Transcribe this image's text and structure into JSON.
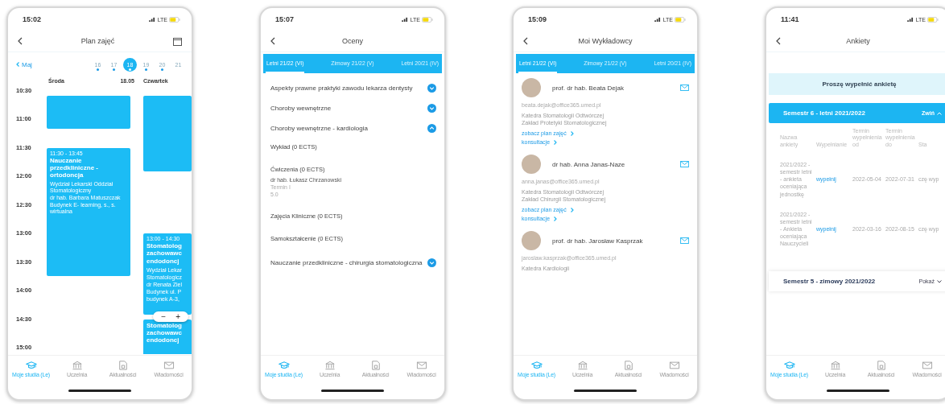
{
  "phones": [
    {
      "kind": "schedule",
      "time": "15:02",
      "network": "LTE",
      "title": "Plan zajęć",
      "calendar_button": true,
      "month": "Maj",
      "days": [
        {
          "label": "16",
          "selected": false,
          "has_events": true
        },
        {
          "label": "17",
          "selected": false,
          "has_events": true
        },
        {
          "label": "18",
          "selected": true,
          "has_events": true
        },
        {
          "label": "19",
          "selected": false,
          "has_events": true
        },
        {
          "label": "20",
          "selected": false,
          "has_events": true
        },
        {
          "label": "21",
          "selected": false,
          "has_events": false
        }
      ],
      "hours": [
        "10:30",
        "11:00",
        "11:30",
        "12:00",
        "12:30",
        "13:00",
        "13:30",
        "14:00",
        "14:30",
        "15:00"
      ],
      "columns": [
        {
          "day": "Środa",
          "date": "18.05",
          "events": [
            {
              "kind": "plain"
            },
            {
              "kind": "detailed",
              "time": "11:30 - 13:45",
              "title": "Nauczanie przedkliniczne - ortodoncja",
              "details": [
                "Wydział Lekarski Oddział Stomatologiczny",
                "dr hab. Barbara Matuszczak",
                "Budynek E- learning, s., s. wirtualna"
              ]
            }
          ]
        },
        {
          "day": "Czwartek",
          "events": [
            {
              "kind": "plain"
            },
            {
              "kind": "detailed",
              "time": "13:00 - 14:30",
              "title": "Stomatolog zachowawc endodoncj",
              "details": [
                "Wydział Lekar",
                "Stomatologicz",
                "dr Renata Ziel",
                "Budynek ul. P",
                "budynek A-3,"
              ]
            },
            {
              "kind": "detailed",
              "title": "Stomatolog zachowawc endodoncj"
            }
          ]
        }
      ],
      "zoom_control": {
        "minus": "−",
        "plus": "+"
      },
      "nav": [
        {
          "label": "Moje studia (Le)",
          "selected": true
        },
        {
          "label": "Uczelnia",
          "selected": false
        },
        {
          "label": "Aktualności",
          "selected": false
        },
        {
          "label": "Wiadomości",
          "selected": false
        }
      ]
    },
    {
      "kind": "grades",
      "time": "15:07",
      "network": "LTE",
      "title": "Oceny",
      "tabs": [
        {
          "label": "Letni 21/22 (VI)",
          "selected": true
        },
        {
          "label": "Zimowy 21/22 (V)",
          "selected": false
        },
        {
          "label": "Letni 20/21 (IV)",
          "selected": false
        }
      ],
      "courses": [
        {
          "name": "Aspekty prawne praktyki zawodu lekarza dentysty",
          "expanded": false
        },
        {
          "name": "Choroby wewnętrzne",
          "expanded": false
        },
        {
          "name": "Choroby wewnętrzne - kardiologia",
          "expanded": true,
          "components": [
            {
              "name": "Wykład (0 ECTS)"
            },
            {
              "name": "Ćwiczenia (0 ECTS)",
              "teacher": "dr hab. Łukasz Chrzanowski",
              "term": "Termin I",
              "grade": "5.0"
            },
            {
              "name": "Zajęcia Kliniczne (0 ECTS)"
            },
            {
              "name": "Samokształcenie (0 ECTS)"
            }
          ]
        },
        {
          "name": "Nauczanie przedkliniczne - chirurgia stomatologiczna",
          "expanded": false
        }
      ],
      "nav": [
        {
          "label": "Moje studia (Le)",
          "selected": true
        },
        {
          "label": "Uczelnia",
          "selected": false
        },
        {
          "label": "Aktualności",
          "selected": false
        },
        {
          "label": "Wiadomości",
          "selected": false
        }
      ]
    },
    {
      "kind": "lecturers",
      "time": "15:09",
      "network": "LTE",
      "title": "Moi Wykładowcy",
      "tabs": [
        {
          "label": "Letni 21/22 (VI)",
          "selected": true
        },
        {
          "label": "Zimowy 21/22 (V)",
          "selected": false
        },
        {
          "label": "Letni 20/21 (IV)",
          "selected": false
        }
      ],
      "lecturers": [
        {
          "name": "prof. dr hab. Beata Dejak",
          "email": "beata.dejak@office365.umed.pl",
          "departments": [
            "Katedra Stomatologii Odtwórczej",
            "Zakład Protetyki Stomatologicznej"
          ],
          "links": [
            "zobacz plan zajęć",
            "konsultacje"
          ]
        },
        {
          "name": "dr hab. Anna Janas-Naze",
          "email": "anna.janas@office365.umed.pl",
          "departments": [
            "Katedra Stomatologii Odtwórczej",
            "Zakład Chirurgii Stomatologicznej"
          ],
          "links": [
            "zobacz plan zajęć",
            "konsultacje"
          ]
        },
        {
          "name": "prof. dr hab. Jarosław Kasprzak",
          "email": "jaroslaw.kasprzak@office365.umed.pl",
          "departments": [
            "Katedra Kardiologii"
          ]
        }
      ],
      "nav": [
        {
          "label": "Moje studia (Le)",
          "selected": true
        },
        {
          "label": "Uczelnia",
          "selected": false
        },
        {
          "label": "Aktualności",
          "selected": false
        },
        {
          "label": "Wiadomości",
          "selected": false
        }
      ]
    },
    {
      "kind": "surveys",
      "time": "11:41",
      "network": "LTE",
      "title": "Ankiety",
      "banner": "Proszę wypełnić ankietę",
      "semesters": [
        {
          "title": "Semestr 6 - letni 2021/2022",
          "toggle": "Zwiń",
          "expanded": true,
          "columns": [
            "Nazwa ankiety",
            "Wypełnianie",
            "Termin wypełnienia od",
            "Termin wypełnienia do",
            "Sta"
          ],
          "rows": [
            {
              "name": "2021/2022 - semestr letni - ankieta oceniająca jednostkę",
              "action": "wypełnij",
              "from": "2022-05-04",
              "to": "2022-07-31",
              "status": "czę wyp"
            },
            {
              "name": "2021/2022 - semestr letni - Ankieta oceniająca Nauczycieli",
              "action": "wypełnij",
              "from": "2022-03-16",
              "to": "2022-08-15",
              "status": "czę wyp"
            }
          ]
        },
        {
          "title": "Semestr 5 - zimowy 2021/2022",
          "toggle": "Pokaż",
          "expanded": false
        }
      ],
      "nav": [
        {
          "label": "Moje studia (Le)",
          "selected": true
        },
        {
          "label": "Uczelnia",
          "selected": false
        },
        {
          "label": "Aktualności",
          "selected": false
        },
        {
          "label": "Wiadomości",
          "selected": false
        }
      ]
    }
  ]
}
